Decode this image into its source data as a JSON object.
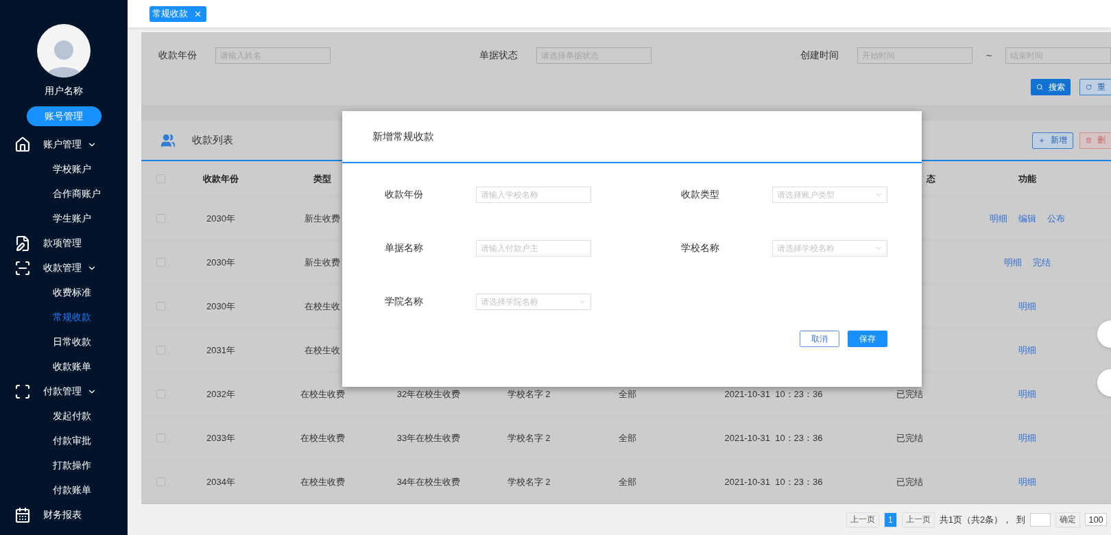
{
  "sidebar": {
    "user_name": "用户名称",
    "account_button": "账号管理",
    "menu": [
      {
        "kind": "group",
        "label": "账户管理",
        "expanded": true,
        "children": [
          {
            "label": "学校账户",
            "selected": false
          },
          {
            "label": "合作商账户",
            "selected": false
          },
          {
            "label": "学生账户",
            "selected": false
          }
        ]
      },
      {
        "kind": "link",
        "label": "款项管理"
      },
      {
        "kind": "group",
        "label": "收款管理",
        "expanded": true,
        "children": [
          {
            "label": "收费标准",
            "selected": false
          },
          {
            "label": "常规收款",
            "selected": true
          },
          {
            "label": "日常收款",
            "selected": false
          },
          {
            "label": "收款账单",
            "selected": false
          }
        ]
      },
      {
        "kind": "group",
        "label": "付款管理",
        "expanded": true,
        "children": [
          {
            "label": "发起付款",
            "selected": false
          },
          {
            "label": "付款审批",
            "selected": false
          },
          {
            "label": "打款操作",
            "selected": false
          },
          {
            "label": "付款账单",
            "selected": false
          }
        ]
      },
      {
        "kind": "link",
        "label": "财务报表"
      }
    ]
  },
  "tabs": [
    {
      "label": "常规收款",
      "selected": true
    }
  ],
  "filters": {
    "fields": [
      {
        "label": "收款年份",
        "placeholder": "请输入姓名"
      },
      {
        "label": "单据状态",
        "placeholder": "请选择单据状态"
      }
    ],
    "created_range": {
      "label": "创建时间",
      "start_placeholder": "开始时间",
      "separator": "~",
      "end_placeholder": "结束时间"
    },
    "buttons": [
      {
        "kind": "search",
        "label": "搜索"
      },
      {
        "kind": "reset",
        "label": "重"
      }
    ]
  },
  "list": {
    "title": "收款列表",
    "buttons": [
      {
        "kind": "add",
        "label": "新增"
      },
      {
        "kind": "delete",
        "label": "删"
      }
    ]
  },
  "table": {
    "select_all_checked": false,
    "header": {
      "year": "收款年份",
      "type": "类型",
      "column_7": "态",
      "actions": "功能"
    },
    "rows": [
      {
        "checked": false,
        "year": "2030年",
        "type": "新生收费",
        "actions": [
          "明细",
          "编辑",
          "公布"
        ]
      },
      {
        "checked": false,
        "year": "2030年",
        "type": "新生收费",
        "actions": [
          "明细",
          "完结"
        ]
      },
      {
        "checked": false,
        "year": "2030年",
        "type": "在校生收",
        "actions": [
          "明细"
        ]
      },
      {
        "checked": false,
        "year": "2031年",
        "type": "在校生收",
        "actions": [
          "明细"
        ]
      },
      {
        "checked": false,
        "year": "2032年",
        "type": "在校生收费",
        "column_3": "32年在校生收费",
        "column_4": "学校名字 2",
        "column_5": "全部",
        "column_6": "2021-10-31  10：23：36",
        "column_7": "已完结",
        "actions": [
          "明细"
        ]
      },
      {
        "checked": false,
        "year": "2033年",
        "type": "在校生收费",
        "column_3": "33年在校生收费",
        "column_4": "学校名字 2",
        "column_5": "全部",
        "column_6": "2021-10-31  10：23：36",
        "column_7": "已完结",
        "actions": [
          "明细"
        ]
      },
      {
        "checked": false,
        "year": "2034年",
        "type": "在校生收费",
        "column_3": "34年在校生收费",
        "column_4": "学校名字 2",
        "column_5": "全部",
        "column_6": "2021-10-31  10：23：36",
        "column_7": "已完结",
        "actions": [
          "明细"
        ]
      }
    ]
  },
  "pagination": {
    "prev": "上一页",
    "pages": [
      {
        "label": "1",
        "selected": true
      }
    ],
    "next": "上一页",
    "summary": "共1页（共2条），",
    "goto_label": "到",
    "confirm": "确定",
    "page_size": "100"
  },
  "dialog": {
    "title": "新增常规收款",
    "fields": [
      {
        "kind": "input",
        "label": "收款年份",
        "placeholder": "请输入学校名称"
      },
      {
        "kind": "select",
        "label": "收款类型",
        "placeholder": "请选择账户类型"
      },
      {
        "kind": "input",
        "label": "单据名称",
        "placeholder": "请输入付款户主"
      },
      {
        "kind": "select",
        "label": "学校名称",
        "placeholder": "请选择学校名称"
      },
      {
        "kind": "select",
        "label": "学院名称",
        "placeholder": "请选择学院名称"
      }
    ],
    "buttons": [
      {
        "kind": "cancel",
        "label": "取消"
      },
      {
        "kind": "save",
        "label": "保存"
      }
    ]
  }
}
